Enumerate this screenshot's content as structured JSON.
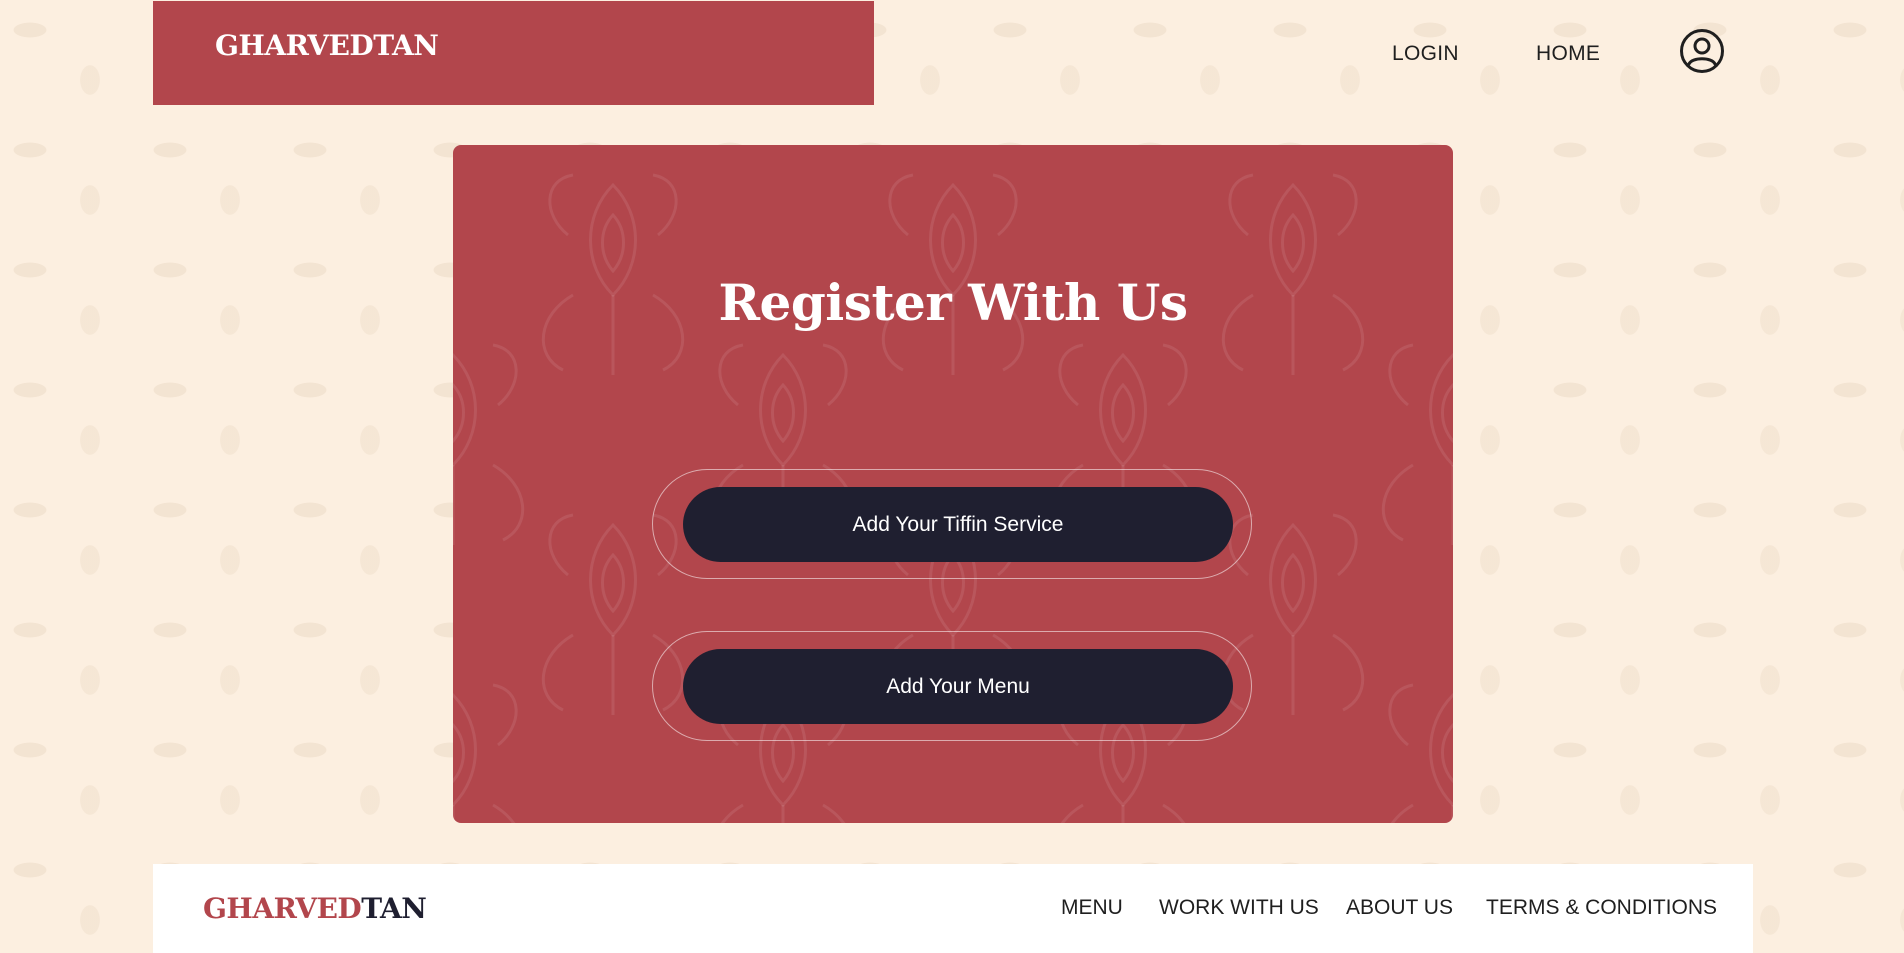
{
  "header": {
    "brand": "GHARVEDTAN",
    "nav": [
      {
        "label": "LOGIN"
      },
      {
        "label": "HOME"
      }
    ],
    "profile_icon": "user-circle-icon"
  },
  "card": {
    "title": "Register With Us",
    "buttons": [
      {
        "label": "Add Your Tiffin Service"
      },
      {
        "label": "Add Your Menu"
      }
    ]
  },
  "footer": {
    "brand_part_a": "GHARVED",
    "brand_part_b": "TAN",
    "links": [
      {
        "label": "MENU"
      },
      {
        "label": "WORK WITH US"
      },
      {
        "label": "ABOUT US"
      },
      {
        "label": "TERMS & CONDITIONS"
      }
    ]
  },
  "colors": {
    "page_background": "#fcefe0",
    "brand_red": "#b2464c",
    "button_dark": "#1f1f30",
    "text_dark": "#1f1f1f",
    "white": "#ffffff"
  }
}
